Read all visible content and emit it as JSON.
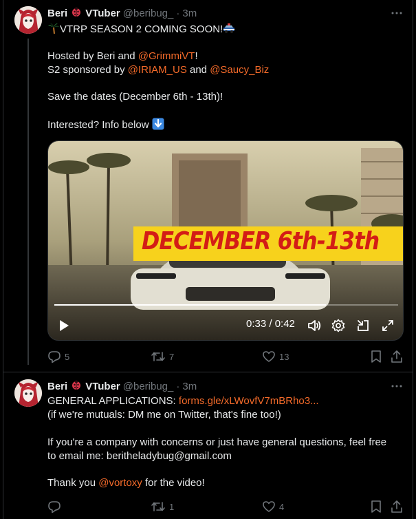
{
  "colors": {
    "background": "#000000",
    "text": "#e7e9ea",
    "muted": "#71767b",
    "link": "#f56b2a",
    "border": "#2f3336"
  },
  "tweets": [
    {
      "author": {
        "name": "Beri",
        "badge_icon": "ladybug-icon",
        "suffix": "VTuber",
        "handle": "@beribug_",
        "time": "3m"
      },
      "lines": [
        {
          "icon": "palm-tree-icon",
          "text": "VTRP SEASON 2 COMING SOON!",
          "trail_icon": "police-car-icon"
        },
        {
          "a": "Hosted by Beri and ",
          "m1": "@GrimmiVT",
          "b": "!"
        },
        {
          "a": "S2 sponsored by ",
          "m1": "@IRIAM_US",
          "b": " and ",
          "m2": "@Saucy_Biz"
        },
        {
          "text": "Save the dates (December 6th - 13th)!"
        },
        {
          "text": "Interested? Info below",
          "trail_icon": "down-arrow-icon"
        }
      ],
      "video": {
        "banner": "DECEMBER 6th-13th",
        "time": "0:33 / 0:42",
        "progress": 0.79
      },
      "actions": {
        "replies": "5",
        "reposts": "7",
        "likes": "13"
      }
    },
    {
      "author": {
        "name": "Beri",
        "badge_icon": "ladybug-icon",
        "suffix": "VTuber",
        "handle": "@beribug_",
        "time": "3m"
      },
      "lines": [
        {
          "a": "GENERAL APPLICATIONS: ",
          "m1": "forms.gle/xLWovfV7mBRho3..."
        },
        {
          "text": "(if we're mutuals: DM me on Twitter, that's fine too!)"
        },
        {
          "text": "If you're a company with concerns or just have general questions, feel free"
        },
        {
          "text": "to email me: beritheladybug@gmail.com"
        },
        {
          "a": "Thank you ",
          "m1": "@vortoxy",
          "b": " for the video!"
        }
      ],
      "actions": {
        "replies": "",
        "reposts": "1",
        "likes": "4"
      }
    }
  ]
}
